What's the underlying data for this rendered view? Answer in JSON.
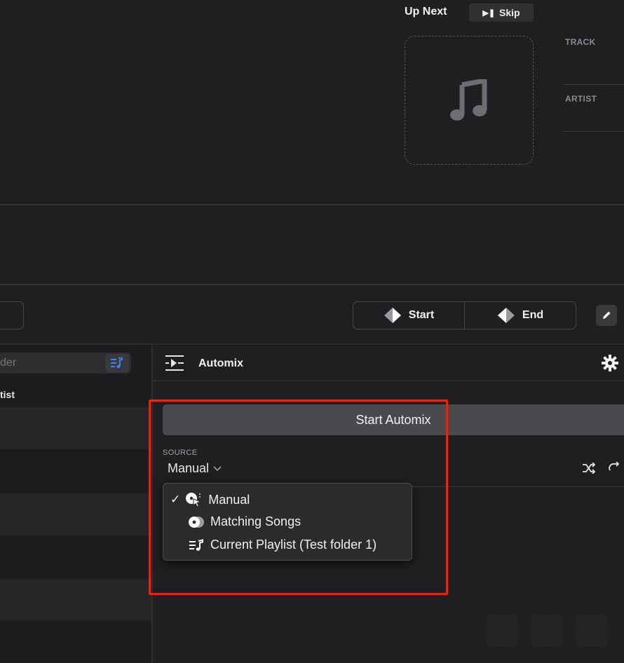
{
  "up_next": {
    "title": "Up Next",
    "skip_label": "Skip",
    "track_label": "TRACK",
    "artist_label": "ARTIST"
  },
  "transport": {
    "start_label": "Start",
    "end_label": "End"
  },
  "library": {
    "search_placeholder_fragment": "der",
    "column_header_fragment": "tist"
  },
  "automix": {
    "title": "Automix",
    "start_button": "Start Automix",
    "source_label": "SOURCE",
    "source_value": "Manual",
    "options": [
      {
        "label": "Manual",
        "icon": "manual-cursor-icon",
        "selected": true
      },
      {
        "label": "Matching Songs",
        "icon": "matching-songs-icon",
        "selected": false
      },
      {
        "label": "Current Playlist (Test folder 1)",
        "icon": "playlist-icon",
        "selected": false
      }
    ]
  },
  "colors": {
    "background": "#1f1f21",
    "button": "#4a4a4e",
    "accent_blue": "#3b82f6",
    "highlight_red": "#e0281a"
  }
}
